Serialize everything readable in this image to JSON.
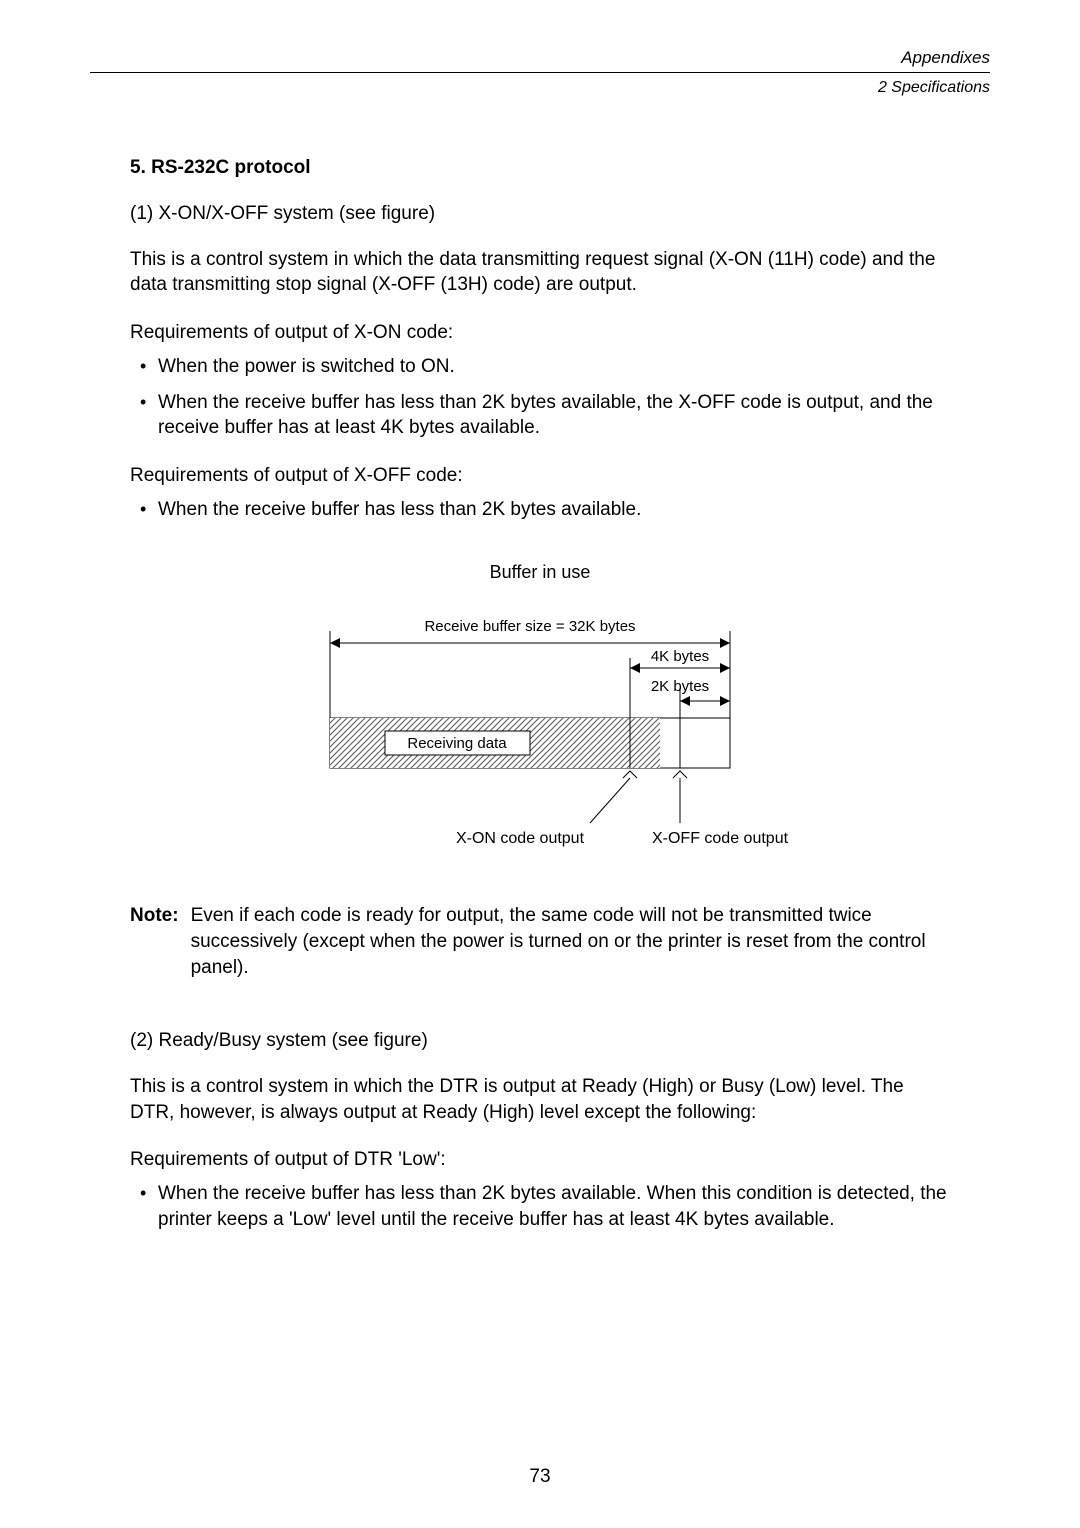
{
  "header": {
    "chapter": "Appendixes",
    "section": "2   Specifications"
  },
  "section5": {
    "title": "5.   RS-232C protocol",
    "sub1_title": "(1)   X-ON/X-OFF system (see figure)",
    "sub1_para": "This is a control system in which the data transmitting request signal (X-ON (11H) code) and the data transmitting stop signal (X-OFF (13H) code) are output.",
    "xon_req_heading": "Requirements of output of X-ON code:",
    "xon_bullets": {
      "b1": "When the power is switched to ON.",
      "b2": "When the receive buffer has less than 2K bytes available, the X-OFF code is output, and the receive buffer has at least 4K bytes available."
    },
    "xoff_req_heading": "Requirements of output of X-OFF code:",
    "xoff_bullets": {
      "b1": "When the receive buffer has less than 2K bytes available."
    }
  },
  "figure": {
    "title": "Buffer in use",
    "buffer_size_label": "Receive buffer size = 32K bytes",
    "label_4k": "4K bytes",
    "label_2k": "2K bytes",
    "receiving_data": "Receiving data",
    "xon_output": "X-ON code output",
    "xoff_output": "X-OFF code output"
  },
  "note": {
    "label": "Note:",
    "text": "Even if each code is ready for output, the same code will not be transmitted twice successively (except when the power is turned on or the printer is reset from the control panel)."
  },
  "section2": {
    "title": "(2)   Ready/Busy system (see figure)",
    "para": "This is a control system in which the DTR is output at Ready (High) or Busy (Low) level. The DTR, however, is always output at Ready (High) level except the following:",
    "dtr_low_heading": "Requirements of output of DTR 'Low':",
    "dtr_bullets": {
      "b1": "When the receive buffer has less than 2K bytes available. When this condition is detected, the printer keeps a 'Low' level until the receive buffer has at least 4K bytes available."
    }
  },
  "page_number": "73"
}
